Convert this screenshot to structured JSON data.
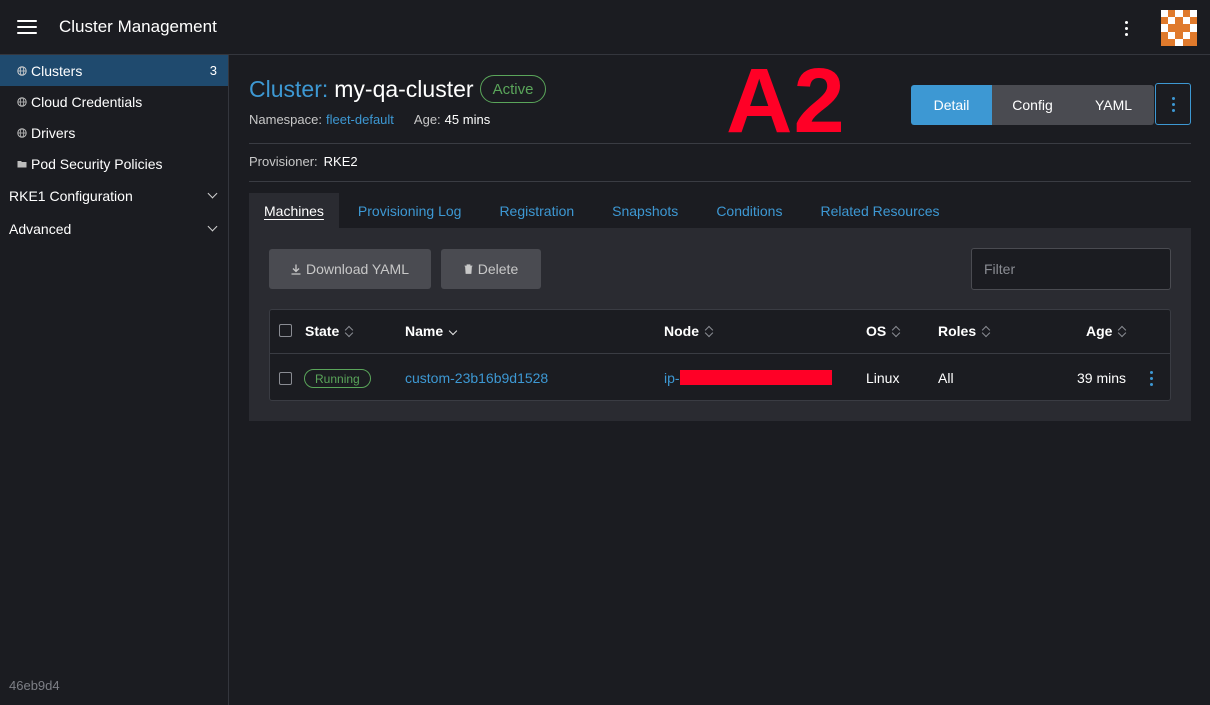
{
  "header": {
    "title": "Cluster Management"
  },
  "sidebar": {
    "items": [
      {
        "label": "Clusters",
        "count": "3",
        "icon": "globe-icon"
      },
      {
        "label": "Cloud Credentials",
        "icon": "globe-icon"
      },
      {
        "label": "Drivers",
        "icon": "globe-icon"
      },
      {
        "label": "Pod Security Policies",
        "icon": "folder-icon"
      }
    ],
    "groups": [
      {
        "label": "RKE1 Configuration"
      },
      {
        "label": "Advanced"
      }
    ],
    "version": "46eb9d4"
  },
  "cluster": {
    "prefix": "Cluster:",
    "name": "my-qa-cluster",
    "status": "Active",
    "namespace_label": "Namespace:",
    "namespace": "fleet-default",
    "age_label": "Age:",
    "age": "45 mins",
    "provisioner_label": "Provisioner:",
    "provisioner": "RKE2"
  },
  "annotation": "A2",
  "view_buttons": [
    "Detail",
    "Config",
    "YAML"
  ],
  "tabs": [
    "Machines",
    "Provisioning Log",
    "Registration",
    "Snapshots",
    "Conditions",
    "Related Resources"
  ],
  "actions": {
    "download": "Download YAML",
    "delete": "Delete",
    "filter_placeholder": "Filter"
  },
  "table": {
    "headers": [
      "State",
      "Name",
      "Node",
      "OS",
      "Roles",
      "Age"
    ],
    "rows": [
      {
        "state": "Running",
        "name": "custom-23b16b9d1528",
        "node": "ip-",
        "os": "Linux",
        "roles": "All",
        "age": "39 mins"
      }
    ]
  },
  "colors": {
    "accent": "#3d98d3",
    "active": "#5aa55a",
    "redaction": "#ff0026",
    "nav_active": "#1f4a6e"
  }
}
